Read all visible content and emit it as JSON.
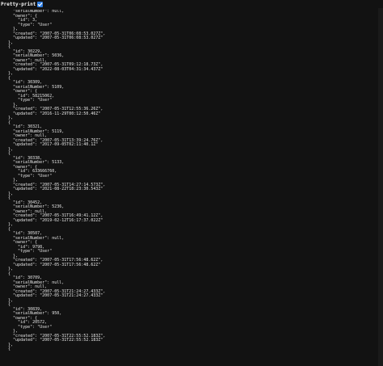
{
  "toolbar": {
    "pretty_print_label": "Pretty-print",
    "pretty_print_checked": true,
    "checkbox_color": "#2e7de1"
  },
  "json_lines": [
    "    \"serialNumber\": null,",
    "    \"owner\": {",
    "      \"id\": 3,",
    "      \"type\": \"User\"",
    "    },",
    "    \"created\": \"2007-05-31T06:08:53.027Z\",",
    "    \"updated\": \"2007-05-31T06:08:53.027Z\"",
    "  },",
    "  {",
    "    \"id\": 30229,",
    "    \"serialNumber\": 5036,",
    "    \"owner\": null,",
    "    \"created\": \"2007-05-31T09:12:18.73Z\",",
    "    \"updated\": \"2022-08-03T04:31:34.437Z\"",
    "  },",
    "  {",
    "    \"id\": 30309,",
    "    \"serialNumber\": 5109,",
    "    \"owner\": {",
    "      \"id\": 58215062,",
    "      \"type\": \"User\"",
    "    },",
    "    \"created\": \"2007-05-31T12:55:36.26Z\",",
    "    \"updated\": \"2016-11-29T00:12:50.46Z\"",
    "  },",
    "  {",
    "    \"id\": 30321,",
    "    \"serialNumber\": 5119,",
    "    \"owner\": null,",
    "    \"created\": \"2007-05-31T13:39:24.76Z\",",
    "    \"updated\": \"2017-09-05T02:11:40.1Z\"",
    "  },",
    "  {",
    "    \"id\": 30338,",
    "    \"serialNumber\": 5133,",
    "    \"owner\": {",
    "      \"id\": 633666760,",
    "      \"type\": \"User\"",
    "    },",
    "    \"created\": \"2007-05-31T14:27:14.573Z\",",
    "    \"updated\": \"2021-08-22T18:23:30.543Z\"",
    "  },",
    "  {",
    "    \"id\": 30452,",
    "    \"serialNumber\": 5236,",
    "    \"owner\": null,",
    "    \"created\": \"2007-05-31T16:49:41.12Z\",",
    "    \"updated\": \"2019-02-12T16:17:37.022Z\"",
    "  },",
    "  {",
    "    \"id\": 30507,",
    "    \"serialNumber\": null,",
    "    \"owner\": {",
    "      \"id\": 9798,",
    "      \"type\": \"User\"",
    "    },",
    "    \"created\": \"2007-05-31T17:56:48.62Z\",",
    "    \"updated\": \"2007-05-31T17:56:48.62Z\"",
    "  },",
    "  {",
    "    \"id\": 30709,",
    "    \"serialNumber\": null,",
    "    \"owner\": null,",
    "    \"created\": \"2007-05-31T21:24:27.433Z\",",
    "    \"updated\": \"2007-05-31T21:24:27.433Z\"",
    "  },",
    "  {",
    "    \"id\": 30839,",
    "    \"serialNumber\": 950,",
    "    \"owner\": {",
    "      \"id\": 20572,",
    "      \"type\": \"User\"",
    "    },",
    "    \"created\": \"2007-05-31T22:55:52.183Z\",",
    "    \"updated\": \"2007-05-31T22:55:52.183Z\"",
    "  },",
    "  {"
  ]
}
